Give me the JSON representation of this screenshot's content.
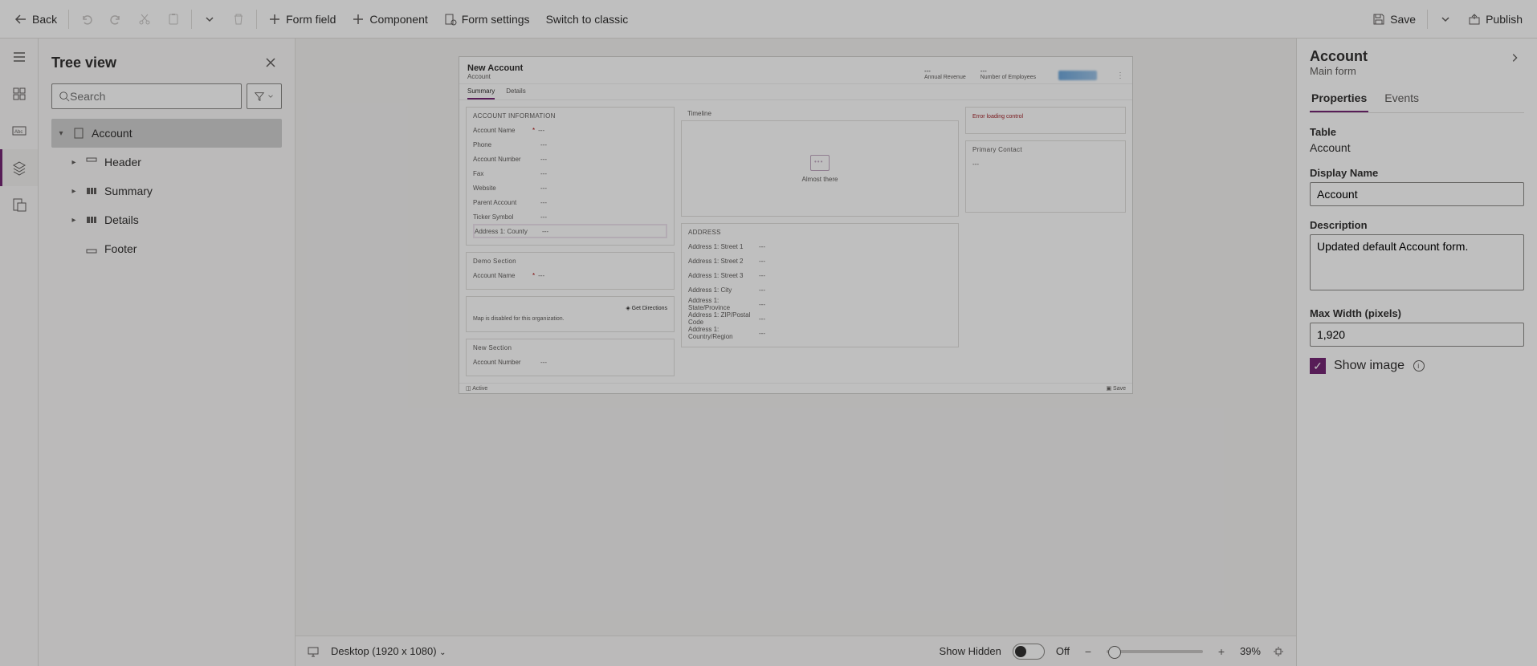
{
  "toolbar": {
    "back": "Back",
    "formField": "Form field",
    "component": "Component",
    "formSettings": "Form settings",
    "switchClassic": "Switch to classic",
    "save": "Save",
    "publish": "Publish"
  },
  "treePanel": {
    "title": "Tree view",
    "searchPlaceholder": "Search",
    "items": {
      "account": "Account",
      "header": "Header",
      "summary": "Summary",
      "details": "Details",
      "footer": "Footer"
    }
  },
  "canvas": {
    "header": {
      "title": "New Account",
      "subtitle": "Account",
      "annualRevenueLabel": "Annual Revenue",
      "employeesLabel": "Number of Employees",
      "dash": "---"
    },
    "tabs": {
      "summary": "Summary",
      "details": "Details"
    },
    "sections": {
      "accountInfo": {
        "title": "ACCOUNT INFORMATION",
        "fields": {
          "accountName": "Account Name",
          "phone": "Phone",
          "accountNumber": "Account Number",
          "fax": "Fax",
          "website": "Website",
          "parentAccount": "Parent Account",
          "tickerSymbol": "Ticker Symbol",
          "address1County": "Address 1: County"
        }
      },
      "demo": {
        "title": "Demo Section",
        "accountName": "Account Name"
      },
      "map": {
        "getDirections": "Get Directions",
        "disabledMsg": "Map is disabled for this organization."
      },
      "newSection": {
        "title": "New Section",
        "accountNumber": "Account Number"
      },
      "timeline": {
        "title": "Timeline",
        "almostThere": "Almost there"
      },
      "address": {
        "title": "ADDRESS",
        "fields": {
          "street1": "Address 1: Street 1",
          "street2": "Address 1: Street 2",
          "street3": "Address 1: Street 3",
          "city": "Address 1: City",
          "state": "Address 1: State/Province",
          "zip": "Address 1: ZIP/Postal Code",
          "country": "Address 1: Country/Region"
        }
      },
      "error": "Error loading control",
      "primaryContact": {
        "title": "Primary Contact"
      }
    },
    "footer": {
      "active": "Active",
      "save": "Save"
    },
    "dash": "---",
    "req": "*"
  },
  "properties": {
    "title": "Account",
    "subtitle": "Main form",
    "tabs": {
      "properties": "Properties",
      "events": "Events"
    },
    "tableLabel": "Table",
    "tableValue": "Account",
    "displayNameLabel": "Display Name",
    "displayNameValue": "Account",
    "descriptionLabel": "Description",
    "descriptionValue": "Updated default Account form.",
    "maxWidthLabel": "Max Width (pixels)",
    "maxWidthValue": "1,920",
    "showImage": "Show image"
  },
  "status": {
    "viewport": "Desktop (1920 x 1080)",
    "showHidden": "Show Hidden",
    "toggleState": "Off",
    "zoomPct": "39%"
  }
}
